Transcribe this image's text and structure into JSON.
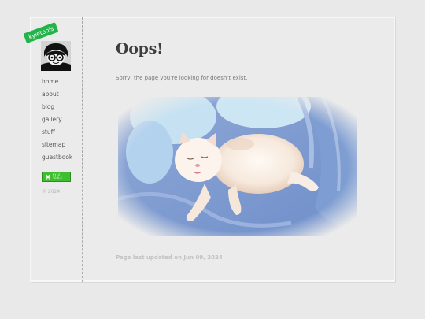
{
  "site": {
    "name": "kyletools",
    "copyright": "© 2024"
  },
  "sidebar": {
    "nav": [
      {
        "label": "home"
      },
      {
        "label": "about"
      },
      {
        "label": "blog"
      },
      {
        "label": "gallery"
      },
      {
        "label": "stuff"
      },
      {
        "label": "sitemap"
      },
      {
        "label": "guestbook"
      }
    ],
    "badge": {
      "text_line1": "KYLE",
      "text_line2": "TOOLS",
      "icon": "deer-icon"
    }
  },
  "main": {
    "title": "Oops!",
    "message": "Sorry, the page you’re looking for doesn’t exist.",
    "image_icon": "kitten-photo",
    "updated": "Page last updated on Jun 09, 2024"
  },
  "colors": {
    "accent": "#22b34a",
    "background": "#e9e9e9",
    "card": "#ebebeb"
  }
}
